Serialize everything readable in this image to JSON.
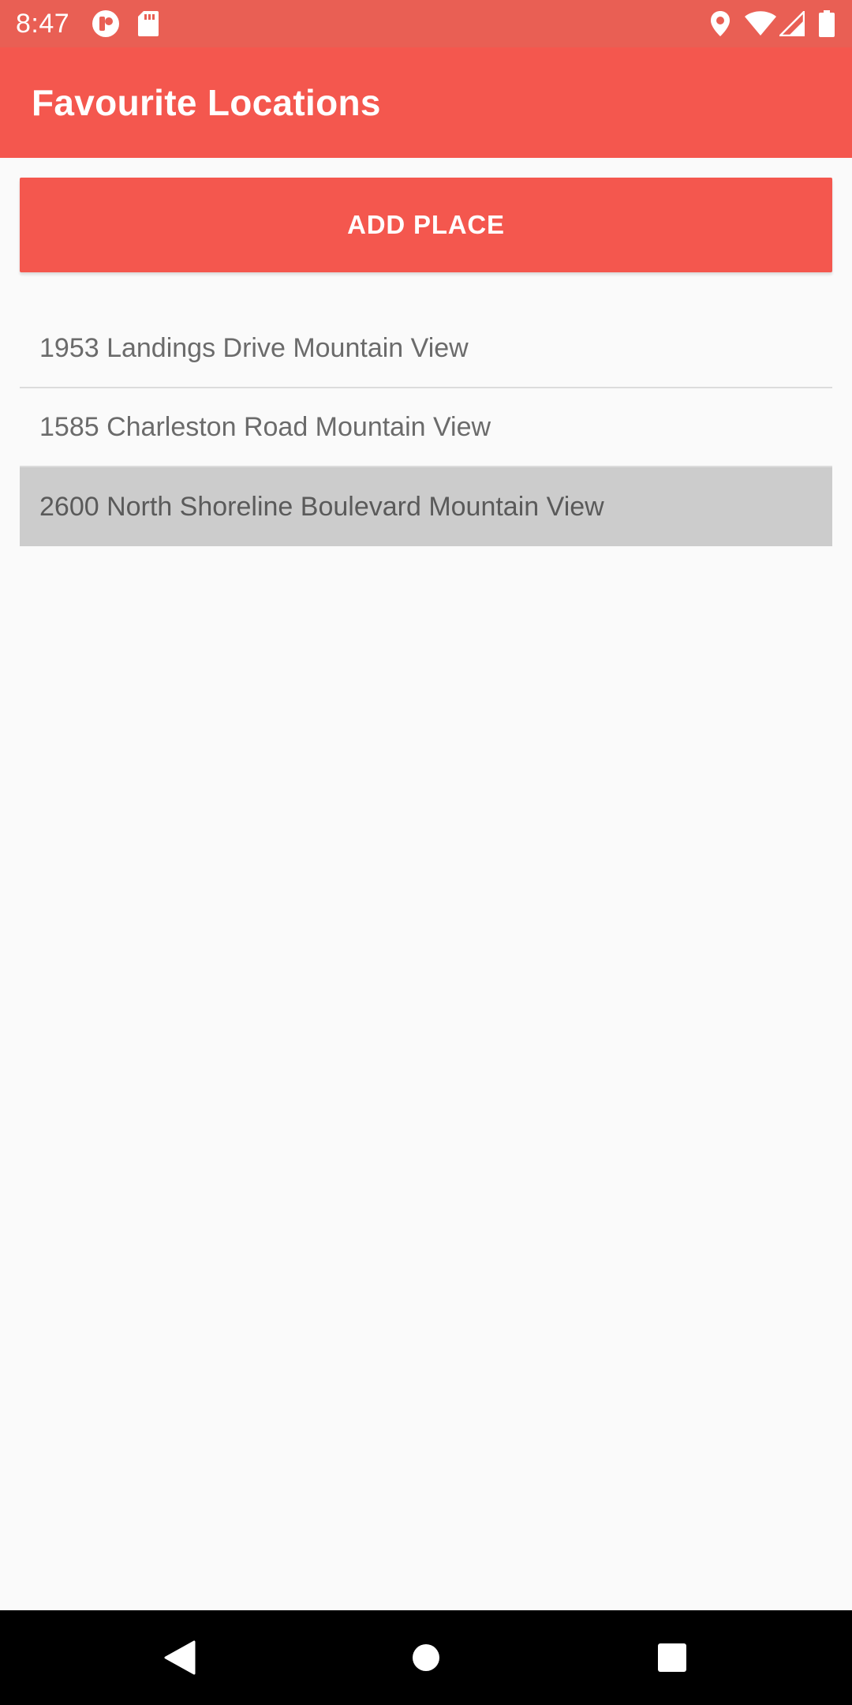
{
  "status_bar": {
    "time": "8:47",
    "left_icons": [
      "notification-app-icon",
      "sd-card-icon"
    ],
    "right_icons": [
      "location-icon",
      "wifi-icon",
      "signal-icon",
      "battery-icon"
    ]
  },
  "app_bar": {
    "title": "Favourite Locations"
  },
  "add_button": {
    "label": "ADD PLACE"
  },
  "places": [
    {
      "label": "1953 Landings Drive Mountain View",
      "selected": false
    },
    {
      "label": "1585 Charleston Road Mountain View",
      "selected": false
    },
    {
      "label": "2600 North Shoreline Boulevard Mountain View",
      "selected": true
    }
  ],
  "nav_bar": {
    "buttons": [
      "back-icon",
      "home-icon",
      "recents-icon"
    ]
  },
  "colors": {
    "primary": "#f4574e",
    "status_bar": "#e95f54",
    "selected_row": "#cccccc",
    "background": "#fafafa"
  }
}
